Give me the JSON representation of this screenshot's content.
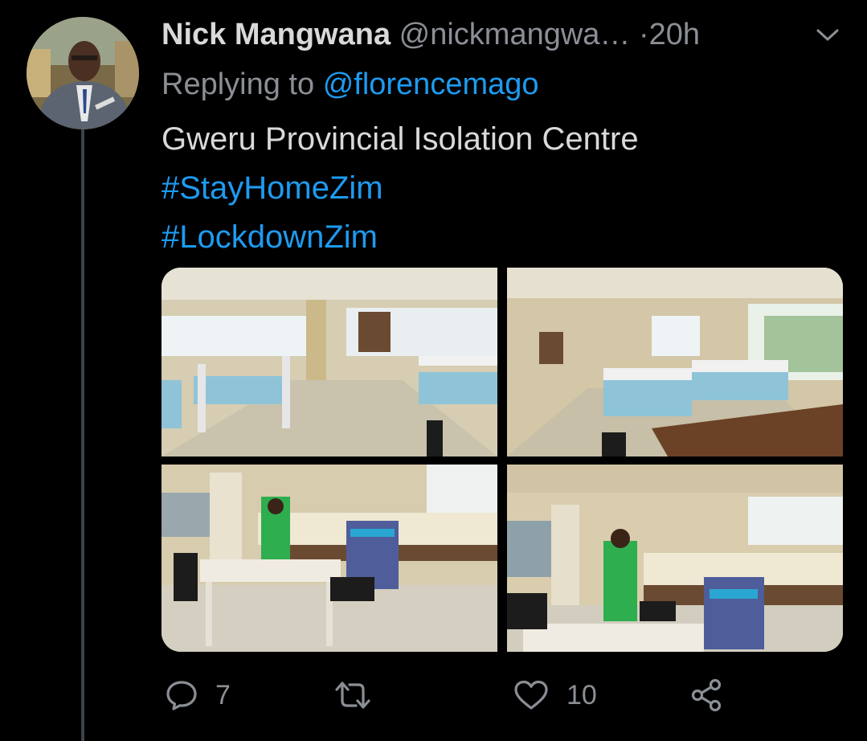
{
  "tweet": {
    "author_name": "Nick Mangwana",
    "author_handle": "@nickmangwa…",
    "separator": "·",
    "time": "20h",
    "reply_prefix": "Replying to",
    "reply_mention": "@florencemago",
    "text": "Gweru Provincial Isolation Centre",
    "hashtags": [
      "#StayHomeZim",
      "#LockdownZim"
    ]
  },
  "actions": {
    "reply_count": "7",
    "retweet_count": "",
    "like_count": "10"
  },
  "icons": {
    "reply": "speech-bubble-icon",
    "retweet": "retweet-arrows-icon",
    "like": "heart-icon",
    "share": "share-nodes-icon",
    "more": "chevron-down-icon"
  },
  "colors": {
    "background": "#000000",
    "link": "#1d9bf0",
    "muted": "#8b8f95",
    "text": "#d9d9d9",
    "thread_line": "#3d4148"
  }
}
